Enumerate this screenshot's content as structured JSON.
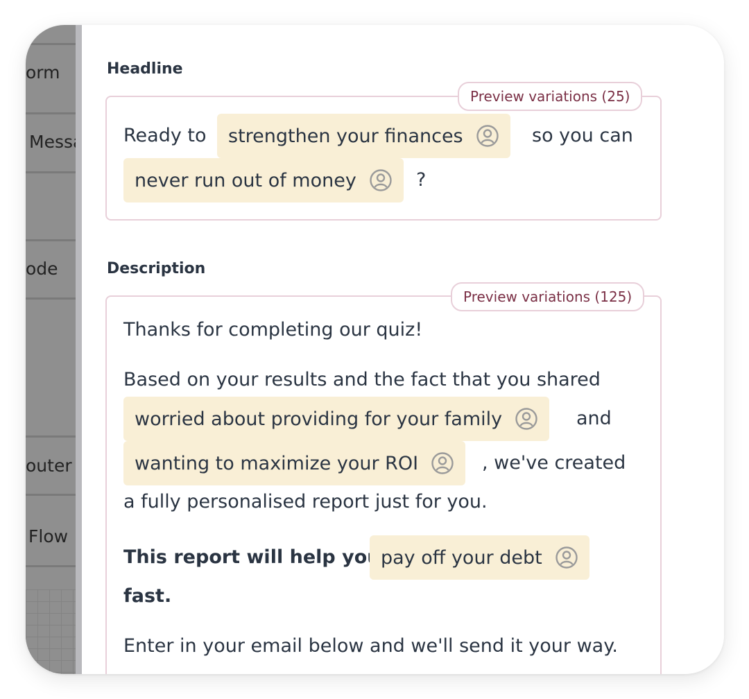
{
  "background_panel": {
    "items": [
      "orm",
      "Messa",
      "ode",
      "outer",
      "Flow"
    ]
  },
  "headline": {
    "label": "Headline",
    "preview_label": "Preview variations (25)",
    "part1": "Ready to",
    "chip1": "strengthen your finances",
    "part2": "so you can",
    "chip2": "never run out of money",
    "part3": "?"
  },
  "description": {
    "label": "Description",
    "preview_label": "Preview variations (125)",
    "line1": "Thanks for completing our quiz!",
    "line2": "Based on your results and the fact that you shared",
    "chip1": "worried about providing for your family",
    "and": "and",
    "chip2": "wanting to maximize your ROI",
    "after_chip2": ", we've created",
    "line3": "a fully personalised report just for you.",
    "help_bold": "This report will help you",
    "chip3": "pay off your debt",
    "fast_bold": "fast.",
    "line4": "Enter in your email below and we'll send it your way."
  },
  "icons": {
    "variable_icon": "user-circle-icon"
  },
  "colors": {
    "chip_bg": "#f9efd6",
    "border": "#e8cfd9",
    "badge_text": "#7a2f45",
    "text": "#2a3442"
  }
}
